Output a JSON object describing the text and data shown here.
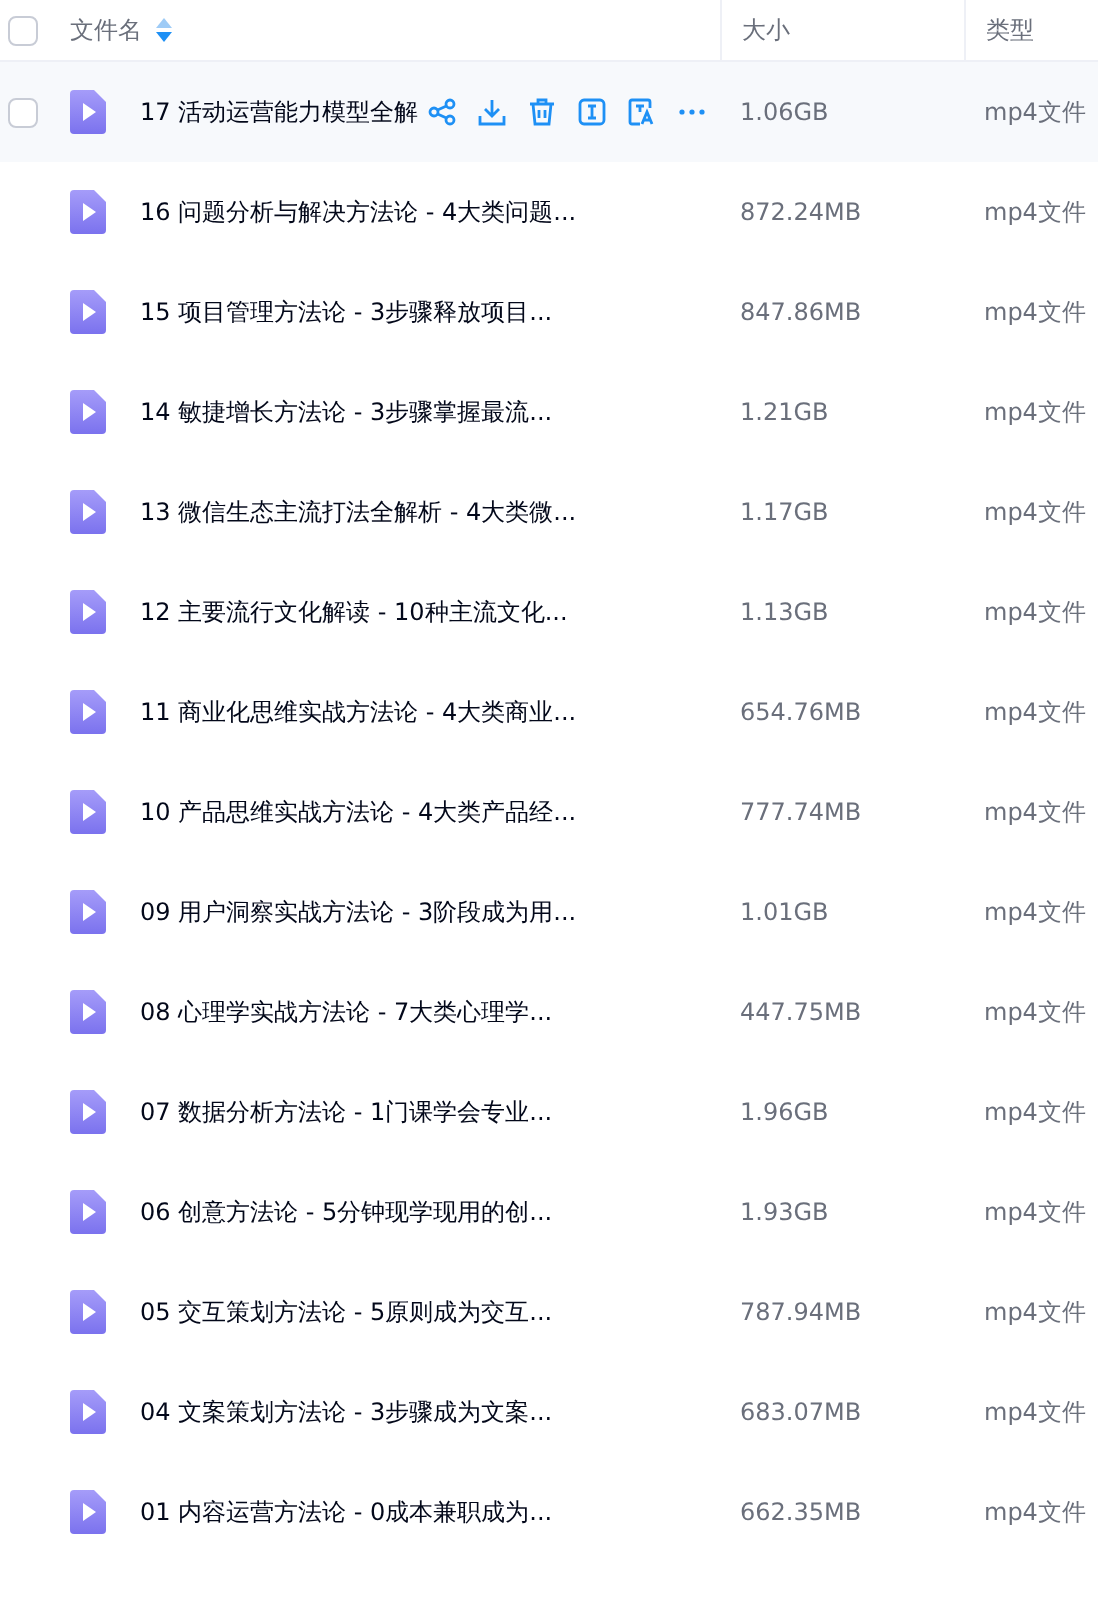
{
  "header": {
    "checked": false,
    "columns": [
      {
        "label": "文件名",
        "sortable": true
      },
      {
        "label": "大小"
      },
      {
        "label": "类型"
      }
    ]
  },
  "rows": [
    {
      "name": "17 活动运营能力模型全解",
      "size": "1.06GB",
      "type": "mp4文件",
      "hovered": true,
      "checked": false
    },
    {
      "name": "16 问题分析与解决方法论 - 4大类问题...",
      "size": "872.24MB",
      "type": "mp4文件",
      "hovered": false,
      "checked": false
    },
    {
      "name": "15 项目管理方法论 - 3步骤释放项目...",
      "size": "847.86MB",
      "type": "mp4文件",
      "hovered": false,
      "checked": false
    },
    {
      "name": "14 敏捷增长方法论 - 3步骤掌握最流...",
      "size": "1.21GB",
      "type": "mp4文件",
      "hovered": false,
      "checked": false
    },
    {
      "name": "13 微信生态主流打法全解析 - 4大类微...",
      "size": "1.17GB",
      "type": "mp4文件",
      "hovered": false,
      "checked": false
    },
    {
      "name": "12 主要流行文化解读 - 10种主流文化...",
      "size": "1.13GB",
      "type": "mp4文件",
      "hovered": false,
      "checked": false
    },
    {
      "name": "11 商业化思维实战方法论 - 4大类商业...",
      "size": "654.76MB",
      "type": "mp4文件",
      "hovered": false,
      "checked": false
    },
    {
      "name": "10 产品思维实战方法论 - 4大类产品经...",
      "size": "777.74MB",
      "type": "mp4文件",
      "hovered": false,
      "checked": false
    },
    {
      "name": "09 用户洞察实战方法论 - 3阶段成为用...",
      "size": "1.01GB",
      "type": "mp4文件",
      "hovered": false,
      "checked": false
    },
    {
      "name": "08 心理学实战方法论 - 7大类心理学...",
      "size": "447.75MB",
      "type": "mp4文件",
      "hovered": false,
      "checked": false
    },
    {
      "name": "07 数据分析方法论 - 1门课学会专业...",
      "size": "1.96GB",
      "type": "mp4文件",
      "hovered": false,
      "checked": false
    },
    {
      "name": "06 创意方法论 - 5分钟现学现用的创...",
      "size": "1.93GB",
      "type": "mp4文件",
      "hovered": false,
      "checked": false
    },
    {
      "name": "05 交互策划方法论 - 5原则成为交互...",
      "size": "787.94MB",
      "type": "mp4文件",
      "hovered": false,
      "checked": false
    },
    {
      "name": "04 文案策划方法论 - 3步骤成为文案...",
      "size": "683.07MB",
      "type": "mp4文件",
      "hovered": false,
      "checked": false
    },
    {
      "name": "01 内容运营方法论 - 0成本兼职成为...",
      "size": "662.35MB",
      "type": "mp4文件",
      "hovered": false,
      "checked": false
    }
  ]
}
